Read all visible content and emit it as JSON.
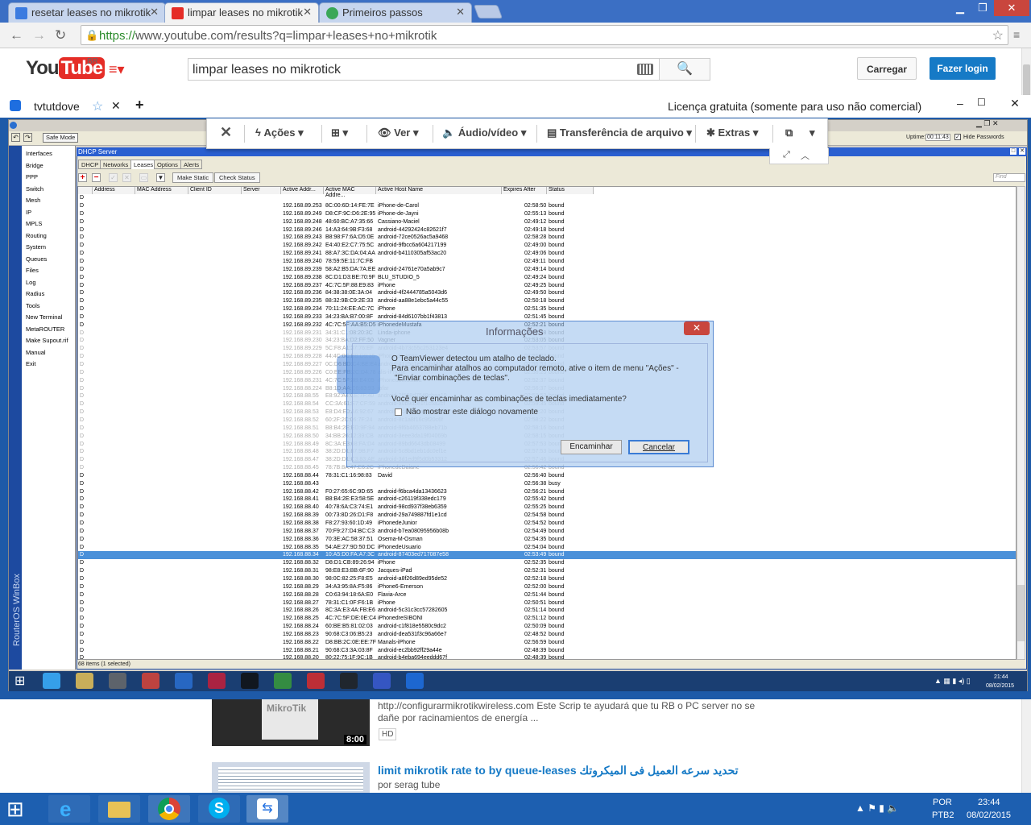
{
  "browser": {
    "tabs": [
      {
        "title": "resetar leases no mikrotik",
        "fav_color": "#3b7be0"
      },
      {
        "title": "limpar leases no mikrotik",
        "fav_color": "#e52d27"
      },
      {
        "title": "Primeiros passos",
        "fav_color": "#3aa757"
      }
    ],
    "url_secure": "https://",
    "url_rest": "www.youtube.com/results?q=limpar+leases+no+mikrotik"
  },
  "youtube": {
    "logo_you": "You",
    "logo_tube": "Tube",
    "region": "BR",
    "search_value": "limpar leases no mikrotick",
    "upload_label": "Carregar",
    "login_label": "Fazer login",
    "results": [
      {
        "desc": "http://configurarmikrotikwireless.com Este Scrip te ayudará que tu RB o PC server no se dañe por racinamientos de energía ...",
        "badge": "HD",
        "duration": "8:00",
        "thumb_text": "MikroTik"
      },
      {
        "title": "limit mikrotik rate to by queue-leases تحديد سرعه العميل فى الميكروتك",
        "author": "por serag tube"
      }
    ]
  },
  "teamviewer": {
    "tab_name": "tvtutdove",
    "license": "Licença gratuita (somente para uso não comercial)",
    "menus": [
      "Ações",
      "Ver",
      "Áudio/vídeo",
      "Transferência de arquivo",
      "Extras"
    ]
  },
  "winbox": {
    "safe_mode": "Safe Mode",
    "uptime_label": "Uptime:",
    "uptime": "00:11:43",
    "hide_passwords": "Hide Passwords",
    "brand": "RouterOS WinBox",
    "menu": [
      "Interfaces",
      "Bridge",
      "PPP",
      "Switch",
      "Mesh",
      "IP",
      "MPLS",
      "Routing",
      "System",
      "Queues",
      "Files",
      "Log",
      "Radius",
      "Tools",
      "New Terminal",
      "MetaROUTER",
      "Make Supout.rif",
      "Manual",
      "Exit"
    ],
    "dhcp_title": "DHCP Server",
    "tabs": [
      "DHCP",
      "Networks",
      "Leases",
      "Options",
      "Alerts"
    ],
    "make_static": "Make Static",
    "check_status": "Check Status",
    "find": "Find",
    "columns": [
      "",
      "Address",
      "MAC Address",
      "Client ID",
      "Server",
      "Active Addr...",
      "Active MAC Addre...",
      "Active Host Name",
      "Expires After",
      "Status"
    ],
    "count": "68 items (1 selected)",
    "rows": [
      [
        "192.168.89.253",
        "8C:00:6D:14:FE:7E",
        "iPhone-de-Carol",
        "02:58:50"
      ],
      [
        "192.168.89.249",
        "D8:CF:9C:D6:2E:95",
        "iPhone-de-Jayni",
        "02:55:13"
      ],
      [
        "192.168.89.248",
        "48:60:BC:A7:35:66",
        "Cassiano-Maciel",
        "02:49:12"
      ],
      [
        "192.168.89.246",
        "14:A3:64:9B:F3:68",
        "android-44292424c82621f7",
        "02:49:18"
      ],
      [
        "192.168.89.243",
        "B8:98:F7:6A:D5:0E",
        "android-72ce0526ac5a9468",
        "02:58:28"
      ],
      [
        "192.168.89.242",
        "E4:40:E2:C7:75:5C",
        "android-9fbcc6a604217199",
        "02:49:00"
      ],
      [
        "192.168.89.241",
        "88:A7:3C:DA:04:AA",
        "android-b4110305af53ac20",
        "02:49:06"
      ],
      [
        "192.168.89.240",
        "78:59:5E:11:7C:FB",
        "",
        "02:49:11"
      ],
      [
        "192.168.89.239",
        "58:A2:B5:DA:7A:EE",
        "android-24761e70a5ab9c7",
        "02:49:14"
      ],
      [
        "192.168.89.238",
        "8C:D1:D3:BE:70:9F",
        "BLU_STUDIO_5",
        "02:49:24"
      ],
      [
        "192.168.89.237",
        "4C:7C:5F:88:E9:83",
        "iPhone",
        "02:49:25"
      ],
      [
        "192.168.89.236",
        "84:38:38:0E:3A:04",
        "android-4f2444785a5043d6",
        "02:49:50"
      ],
      [
        "192.168.89.235",
        "88:32:9B:C9:2E:33",
        "android-aa88e1ebc5a44c55",
        "02:50:18"
      ],
      [
        "192.168.89.234",
        "70:11:24:EE:AC:7C",
        "iPhone",
        "02:51:35"
      ],
      [
        "192.168.89.233",
        "34:23:BA:B7:00:8F",
        "android-84d6107bb1f43813",
        "02:51:45"
      ],
      [
        "192.168.89.232",
        "4C:7C:5F:AA:B5:D5",
        "iPhonedeMustafa",
        "02:52:21"
      ],
      [
        "192.168.89.231",
        "34:31:C1:08:20:3C",
        "Linda-iphone",
        "02:52:48"
      ],
      [
        "192.168.89.230",
        "34:23:BA:D2:FF:50",
        "Vagner",
        "02:53:05"
      ],
      [
        "192.168.89.229",
        "5C:F8:A1:37:76:EF",
        "android-4b73c55c253123e4",
        "02:53:57"
      ],
      [
        "192.168.89.228",
        "44:4C:0C:BB:D9:35",
        "iPhone-de-Iman",
        "02:55:23"
      ],
      [
        "192.168.89.227",
        "0C:D6:BD:C4:BE:E4",
        "android-4125c1eff2cbd93c",
        "02:55:53"
      ],
      [
        "192.168.89.226",
        "C0:EE:FB:2C:D4:78",
        "alis-iPhone",
        "02:56:25"
      ],
      [
        "192.168.88.231",
        "4C:7C:5F:3B:E4:05",
        "iPhonedeMustafa",
        "02:52:37"
      ],
      [
        "192.168.88.224",
        "B8:1D:AA:E6:83:93",
        "jafar",
        "02:56:37"
      ],
      [
        "192.168.88.55",
        "E8:92:A4:CE:7F:40",
        "android-2f568d7548cbaa19",
        "02:59:53"
      ],
      [
        "192.168.88.54",
        "CC:3A:61:E7:CF:59",
        "android-a0b9d2e1f1c5a2cf",
        "02:59:35"
      ],
      [
        "192.168.88.53",
        "E8:D4:E0:A6:92:67",
        "android-5c4b3d4a0b2e8172",
        "02:59:20"
      ],
      [
        "192.168.88.52",
        "60:2F:2C:06:7F:24",
        "android-8c1a8f16c9f20c6f",
        "02:58:22"
      ],
      [
        "192.168.88.51",
        "B8:B4:2E:ED:9F:94",
        "android-9f6b4653788eb71b",
        "02:58:16"
      ],
      [
        "192.168.88.50",
        "34:BB:26:12:39:CB",
        "android-3eee3da19f04069b",
        "02:58:15"
      ],
      [
        "192.168.88.49",
        "8C:3A:E3:68:FA:D4",
        "android-89bd6643db08499",
        "02:57:53"
      ],
      [
        "192.168.88.48",
        "38:2D:D1:87:9B:F7",
        "android-5c8bd1eb1dc0ef1e",
        "02:57:53"
      ],
      [
        "192.168.88.47",
        "38:2D:D1:C3:83:AE",
        "android-3d1ed9f5d0b53312",
        "02:57:46"
      ],
      [
        "192.168.88.45",
        "78:7B:8A:47:E6:2C",
        "iPhonedeDaiane",
        "02:56:42"
      ],
      [
        "192.168.88.44",
        "78:31:C1:16:98:83",
        "David",
        "02:56:40"
      ],
      [
        "192.168.88.43",
        "",
        "",
        "02:56:38"
      ],
      [
        "192.168.88.42",
        "F0:27:65:6C:9D:65",
        "android-f6bca4da13436623",
        "02:56:21"
      ],
      [
        "192.168.88.41",
        "B8:B4:2E:E3:58:5E",
        "android-c26119f338edc179",
        "02:55:42"
      ],
      [
        "192.168.88.40",
        "40:78:6A:C3:74:E1",
        "android-98cd937f38eb6359",
        "02:55:25"
      ],
      [
        "192.168.88.39",
        "00:73:8D:26:D1:F8",
        "android-29a749887fd1e1cd",
        "02:54:58"
      ],
      [
        "192.168.88.38",
        "F8:27:93:60:1D:49",
        "iPhonedeJunior",
        "02:54:52"
      ],
      [
        "192.168.88.37",
        "70:F9:27:D4:BC:C3",
        "android-b7ea08095956b08b",
        "02:54:49"
      ],
      [
        "192.168.88.36",
        "70:3E:AC:58:37:51",
        "Osema-M-Osman",
        "02:54:35"
      ],
      [
        "192.168.88.35",
        "54:AE:27:9D:50:DC",
        "iPhonedeUsuario",
        "02:54:04"
      ],
      [
        "192.168.88.34",
        "10:A5:D0:FA:A7:3C",
        "android-87403ed717087e58",
        "02:53:49"
      ],
      [
        "192.168.88.32",
        "D8:D1:CB:89:26:94",
        "iPhone",
        "02:52:35"
      ],
      [
        "192.168.88.31",
        "98:E8:E3:BB:6F:90",
        "Jacques-iPad",
        "02:52:31"
      ],
      [
        "192.168.88.30",
        "98:0C:82:25:F8:E5",
        "android-a8f26d89ed95de52",
        "02:52:18"
      ],
      [
        "192.168.88.29",
        "34:A3:95:8A:F5:86",
        "iPhone6-Emerson",
        "02:52:00"
      ],
      [
        "192.168.88.28",
        "C0:63:94:18:6A:E0",
        "Flavia-Arce",
        "02:51:44"
      ],
      [
        "192.168.88.27",
        "78:31:C1:0F:F6:1B",
        "iPhone",
        "02:50:51"
      ],
      [
        "192.168.88.26",
        "8C:3A:E3:4A:FB:E6",
        "android-5c31c3cc57282605",
        "02:51:14"
      ],
      [
        "192.168.88.25",
        "4C:7C:5F:DE:0E:C4",
        "iPhonedreSIBONI",
        "02:51:12"
      ],
      [
        "192.168.88.24",
        "60:BE:B5:81:02:03",
        "android-c1f818e5580c9dc2",
        "02:50:09"
      ],
      [
        "192.168.88.23",
        "90:68:C3:06:B5:23",
        "android-dea531f3c96a66e7",
        "02:48:52"
      ],
      [
        "192.168.88.22",
        "D8:BB:2C:0E:EE:7F",
        "Manals-iPhone",
        "02:56:59"
      ],
      [
        "192.168.88.21",
        "90:68:C3:3A:03:8F",
        "android-ec2bb92ff29a44e",
        "02:48:39"
      ],
      [
        "192.168.88.20",
        "80:22:75:1F:9C:1B",
        "android-b4eba694eeddd67f",
        "02:48:39"
      ]
    ],
    "selected_row_index": 44,
    "busy_row_index": 35,
    "status_bound": "bound",
    "status_busy": "busy",
    "row_prefix": "D"
  },
  "dialog": {
    "title": "Informações",
    "line1": "O TeamViewer detectou um atalho de teclado.",
    "line2": "Para encaminhar atalhos ao computador remoto, ative o item de menu \"Ações\" -",
    "line3": "\"Enviar combinações de teclas\".",
    "question": "Você quer encaminhar as combinações de teclas imediatamente?",
    "dont_show": "Não mostrar este diálogo novamente",
    "forward": "Encaminhar",
    "cancel": "Cancelar"
  },
  "remote_clock": {
    "time": "21:44",
    "date": "08/02/2015"
  },
  "taskbar": {
    "lang1": "POR",
    "lang2": "PTB2",
    "time": "23:44",
    "date": "08/02/2015"
  }
}
